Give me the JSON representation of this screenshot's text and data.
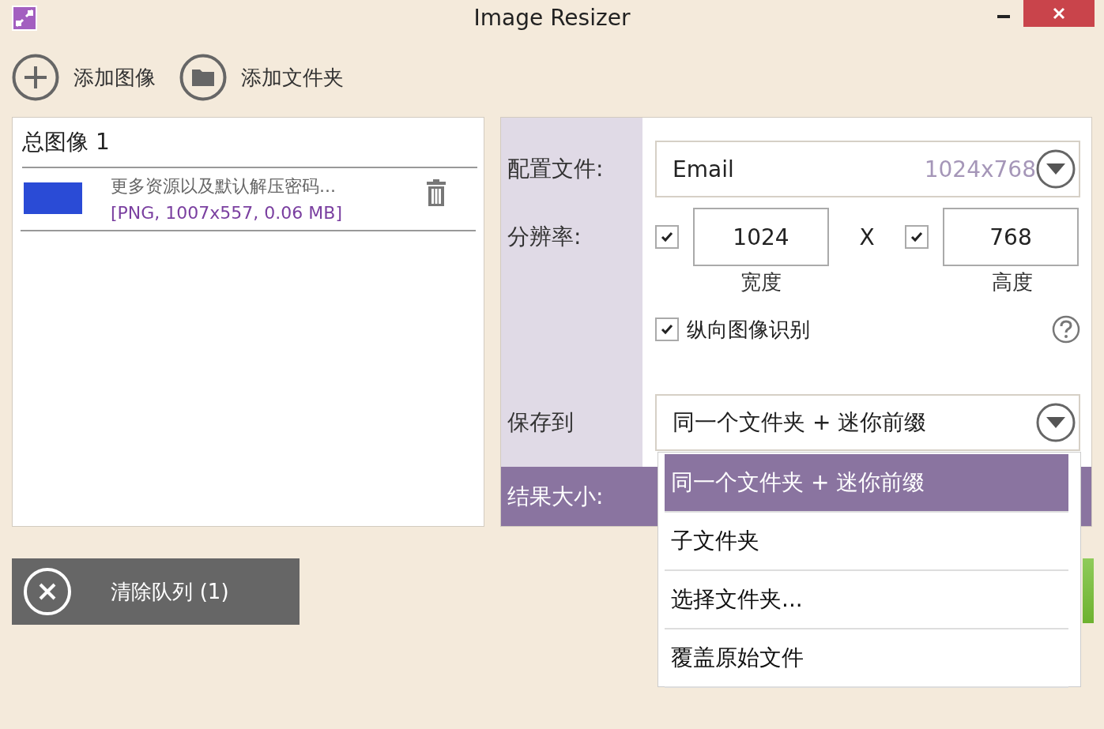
{
  "window": {
    "title": "Image Resizer"
  },
  "toolbar": [
    {
      "label": "添加图像",
      "kind": "add"
    },
    {
      "label": "添加文件夹",
      "kind": "folder"
    }
  ],
  "queue": {
    "title": "总图像 1",
    "items": [
      {
        "name": "更多资源以及默认解压密码...",
        "info": "[PNG, 1007x557, 0.06 MB]"
      }
    ]
  },
  "settings": {
    "profile_label": "配置文件:",
    "profile": {
      "value": "Email",
      "size": "1024x768"
    },
    "resolution_label": "分辨率:",
    "width": {
      "checked": true,
      "value": "1024",
      "caption": "宽度"
    },
    "separator": "X",
    "height": {
      "checked": true,
      "value": "768",
      "caption": "高度"
    },
    "portrait": {
      "checked": true,
      "label": "纵向图像识别"
    },
    "save_label": "保存到",
    "save_value": "同一个文件夹 + 迷你前缀",
    "result_label": "结果大小:"
  },
  "clear_button": {
    "label": "清除队列 (1)"
  },
  "dropdown": {
    "options": [
      {
        "label": "同一个文件夹 + 迷你前缀",
        "selected": true
      },
      {
        "label": "子文件夹",
        "selected": false
      },
      {
        "label": "选择文件夹...",
        "selected": false
      },
      {
        "label": "覆盖原始文件",
        "selected": false
      }
    ]
  }
}
